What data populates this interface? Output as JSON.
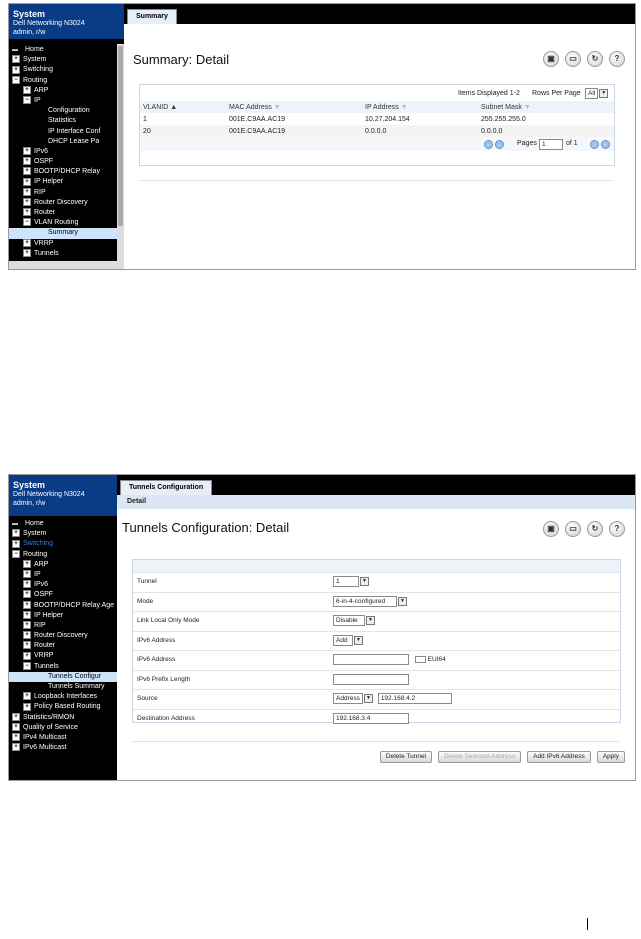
{
  "shot1": {
    "nav": {
      "system": "System",
      "device": "Dell Networking N3024",
      "user": "admin, r/w",
      "items": [
        {
          "label": "Home",
          "indent": 0,
          "pm": "none"
        },
        {
          "label": "System",
          "indent": 0,
          "pm": "+"
        },
        {
          "label": "Switching",
          "indent": 0,
          "pm": "+"
        },
        {
          "label": "Routing",
          "indent": 0,
          "pm": "-"
        },
        {
          "label": "ARP",
          "indent": 1,
          "pm": "+"
        },
        {
          "label": "IP",
          "indent": 1,
          "pm": "-"
        },
        {
          "label": "Configuration",
          "indent": 2,
          "pm": "none"
        },
        {
          "label": "Statistics",
          "indent": 2,
          "pm": "none"
        },
        {
          "label": "IP Interface Conf",
          "indent": 2,
          "pm": "none"
        },
        {
          "label": "DHCP Lease Pa",
          "indent": 2,
          "pm": "none"
        },
        {
          "label": "IPv6",
          "indent": 1,
          "pm": "+"
        },
        {
          "label": "OSPF",
          "indent": 1,
          "pm": "+"
        },
        {
          "label": "BOOTP/DHCP Relay",
          "indent": 1,
          "pm": "+"
        },
        {
          "label": "IP Helper",
          "indent": 1,
          "pm": "+"
        },
        {
          "label": "RIP",
          "indent": 1,
          "pm": "+"
        },
        {
          "label": "Router Discovery",
          "indent": 1,
          "pm": "+"
        },
        {
          "label": "Router",
          "indent": 1,
          "pm": "+"
        },
        {
          "label": "VLAN Routing",
          "indent": 1,
          "pm": "-"
        },
        {
          "label": "Summary",
          "indent": 2,
          "pm": "none",
          "selected": true
        },
        {
          "label": "VRRP",
          "indent": 1,
          "pm": "+"
        },
        {
          "label": "Tunnels",
          "indent": 1,
          "pm": "+"
        }
      ]
    },
    "tab": "Summary",
    "title": "Summary: Detail",
    "items_displayed": "Items Displayed 1-2",
    "rows_per_page_label": "Rows Per Page",
    "rows_per_page": "All",
    "columns": [
      "VLANID",
      "MAC Address",
      "IP Address",
      "Subnet Mask"
    ],
    "rows": [
      [
        "1",
        "001E.C9AA.AC19",
        "10.27.204.154",
        "255.255.255.0"
      ],
      [
        "20",
        "001E.C9AA.AC19",
        "0.0.0.0",
        "0.0.0.0"
      ]
    ],
    "pages_label": "Pages",
    "page": "1",
    "of_pages": "of 1"
  },
  "shot2": {
    "nav": {
      "system": "System",
      "device": "Dell Networking N3024",
      "user": "admin, r/w",
      "items": [
        {
          "label": "Home",
          "indent": 0,
          "pm": "none"
        },
        {
          "label": "System",
          "indent": 0,
          "pm": "+"
        },
        {
          "label": "Switching",
          "indent": 0,
          "pm": "+",
          "blue": true
        },
        {
          "label": "Routing",
          "indent": 0,
          "pm": "-"
        },
        {
          "label": "ARP",
          "indent": 1,
          "pm": "+"
        },
        {
          "label": "IP",
          "indent": 1,
          "pm": "+"
        },
        {
          "label": "IPv6",
          "indent": 1,
          "pm": "+"
        },
        {
          "label": "OSPF",
          "indent": 1,
          "pm": "+"
        },
        {
          "label": "BOOTP/DHCP Relay Age",
          "indent": 1,
          "pm": "+"
        },
        {
          "label": "IP Helper",
          "indent": 1,
          "pm": "+"
        },
        {
          "label": "RIP",
          "indent": 1,
          "pm": "+"
        },
        {
          "label": "Router Discovery",
          "indent": 1,
          "pm": "+"
        },
        {
          "label": "Router",
          "indent": 1,
          "pm": "+"
        },
        {
          "label": "VRRP",
          "indent": 1,
          "pm": "+"
        },
        {
          "label": "Tunnels",
          "indent": 1,
          "pm": "-"
        },
        {
          "label": "Tunnels Configur",
          "indent": 2,
          "pm": "none",
          "selected": true
        },
        {
          "label": "Tunnels Summary",
          "indent": 2,
          "pm": "none"
        },
        {
          "label": "Loopback Interfaces",
          "indent": 1,
          "pm": "+"
        },
        {
          "label": "Policy Based Routing",
          "indent": 1,
          "pm": "+"
        },
        {
          "label": "Statistics/RMON",
          "indent": 0,
          "pm": "+"
        },
        {
          "label": "Quality of Service",
          "indent": 0,
          "pm": "+"
        },
        {
          "label": "IPv4 Multicast",
          "indent": 0,
          "pm": "+"
        },
        {
          "label": "IPv6 Multicast",
          "indent": 0,
          "pm": "+"
        }
      ]
    },
    "tab": "Tunnels Configuration",
    "subtab": "Detail",
    "title": "Tunnels Configuration: Detail",
    "fields": {
      "tunnel_label": "Tunnel",
      "tunnel_value": "1",
      "mode_label": "Mode",
      "mode_value": "6-in-4-configured",
      "link_local_label": "Link Local Only Mode",
      "link_local_value": "Disable",
      "ipv6_address_action_label": "IPv6 Address",
      "ipv6_address_action_value": "Add",
      "ipv6_address_label": "IPv6 Address",
      "ipv6_address_value": "",
      "eui64_label": "EUI64",
      "prefix_label": "IPv6 Prefix Length",
      "prefix_value": "",
      "source_label": "Source",
      "source_type": "Address",
      "source_value": "192.168.4.2",
      "destination_label": "Destination Address",
      "destination_value": "192.168.3.4"
    },
    "buttons": {
      "delete_tunnel": "Delete Tunnel",
      "delete_selected": "Delete Selected Address",
      "add_ipv6": "Add IPv6 Address",
      "apply": "Apply"
    }
  }
}
